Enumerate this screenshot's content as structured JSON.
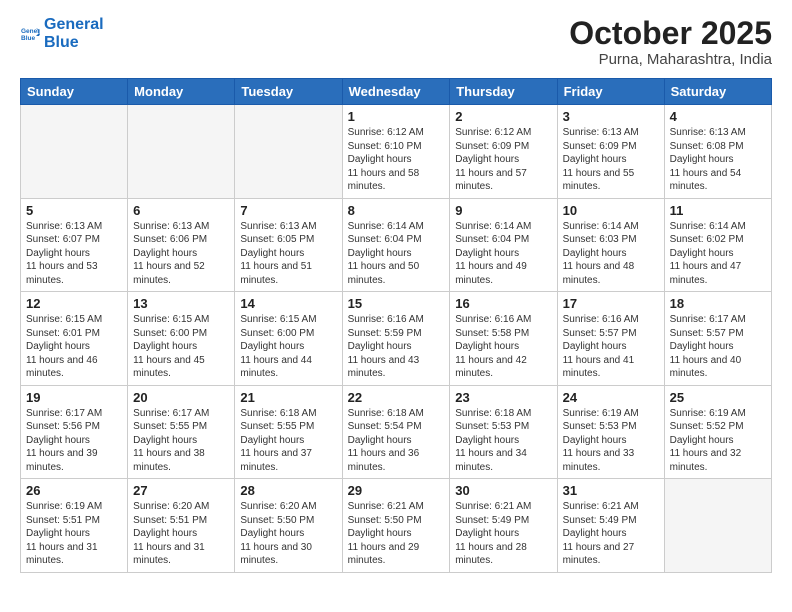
{
  "header": {
    "logo_line1": "General",
    "logo_line2": "Blue",
    "month_title": "October 2025",
    "location": "Purna, Maharashtra, India"
  },
  "weekdays": [
    "Sunday",
    "Monday",
    "Tuesday",
    "Wednesday",
    "Thursday",
    "Friday",
    "Saturday"
  ],
  "weeks": [
    [
      {
        "day": "",
        "empty": true
      },
      {
        "day": "",
        "empty": true
      },
      {
        "day": "",
        "empty": true
      },
      {
        "day": "1",
        "sr": "6:12 AM",
        "ss": "6:10 PM",
        "dl": "11 hours and 58 minutes."
      },
      {
        "day": "2",
        "sr": "6:12 AM",
        "ss": "6:09 PM",
        "dl": "11 hours and 57 minutes."
      },
      {
        "day": "3",
        "sr": "6:13 AM",
        "ss": "6:09 PM",
        "dl": "11 hours and 55 minutes."
      },
      {
        "day": "4",
        "sr": "6:13 AM",
        "ss": "6:08 PM",
        "dl": "11 hours and 54 minutes."
      }
    ],
    [
      {
        "day": "5",
        "sr": "6:13 AM",
        "ss": "6:07 PM",
        "dl": "11 hours and 53 minutes."
      },
      {
        "day": "6",
        "sr": "6:13 AM",
        "ss": "6:06 PM",
        "dl": "11 hours and 52 minutes."
      },
      {
        "day": "7",
        "sr": "6:13 AM",
        "ss": "6:05 PM",
        "dl": "11 hours and 51 minutes."
      },
      {
        "day": "8",
        "sr": "6:14 AM",
        "ss": "6:04 PM",
        "dl": "11 hours and 50 minutes."
      },
      {
        "day": "9",
        "sr": "6:14 AM",
        "ss": "6:04 PM",
        "dl": "11 hours and 49 minutes."
      },
      {
        "day": "10",
        "sr": "6:14 AM",
        "ss": "6:03 PM",
        "dl": "11 hours and 48 minutes."
      },
      {
        "day": "11",
        "sr": "6:14 AM",
        "ss": "6:02 PM",
        "dl": "11 hours and 47 minutes."
      }
    ],
    [
      {
        "day": "12",
        "sr": "6:15 AM",
        "ss": "6:01 PM",
        "dl": "11 hours and 46 minutes."
      },
      {
        "day": "13",
        "sr": "6:15 AM",
        "ss": "6:00 PM",
        "dl": "11 hours and 45 minutes."
      },
      {
        "day": "14",
        "sr": "6:15 AM",
        "ss": "6:00 PM",
        "dl": "11 hours and 44 minutes."
      },
      {
        "day": "15",
        "sr": "6:16 AM",
        "ss": "5:59 PM",
        "dl": "11 hours and 43 minutes."
      },
      {
        "day": "16",
        "sr": "6:16 AM",
        "ss": "5:58 PM",
        "dl": "11 hours and 42 minutes."
      },
      {
        "day": "17",
        "sr": "6:16 AM",
        "ss": "5:57 PM",
        "dl": "11 hours and 41 minutes."
      },
      {
        "day": "18",
        "sr": "6:17 AM",
        "ss": "5:57 PM",
        "dl": "11 hours and 40 minutes."
      }
    ],
    [
      {
        "day": "19",
        "sr": "6:17 AM",
        "ss": "5:56 PM",
        "dl": "11 hours and 39 minutes."
      },
      {
        "day": "20",
        "sr": "6:17 AM",
        "ss": "5:55 PM",
        "dl": "11 hours and 38 minutes."
      },
      {
        "day": "21",
        "sr": "6:18 AM",
        "ss": "5:55 PM",
        "dl": "11 hours and 37 minutes."
      },
      {
        "day": "22",
        "sr": "6:18 AM",
        "ss": "5:54 PM",
        "dl": "11 hours and 36 minutes."
      },
      {
        "day": "23",
        "sr": "6:18 AM",
        "ss": "5:53 PM",
        "dl": "11 hours and 34 minutes."
      },
      {
        "day": "24",
        "sr": "6:19 AM",
        "ss": "5:53 PM",
        "dl": "11 hours and 33 minutes."
      },
      {
        "day": "25",
        "sr": "6:19 AM",
        "ss": "5:52 PM",
        "dl": "11 hours and 32 minutes."
      }
    ],
    [
      {
        "day": "26",
        "sr": "6:19 AM",
        "ss": "5:51 PM",
        "dl": "11 hours and 31 minutes."
      },
      {
        "day": "27",
        "sr": "6:20 AM",
        "ss": "5:51 PM",
        "dl": "11 hours and 31 minutes."
      },
      {
        "day": "28",
        "sr": "6:20 AM",
        "ss": "5:50 PM",
        "dl": "11 hours and 30 minutes."
      },
      {
        "day": "29",
        "sr": "6:21 AM",
        "ss": "5:50 PM",
        "dl": "11 hours and 29 minutes."
      },
      {
        "day": "30",
        "sr": "6:21 AM",
        "ss": "5:49 PM",
        "dl": "11 hours and 28 minutes."
      },
      {
        "day": "31",
        "sr": "6:21 AM",
        "ss": "5:49 PM",
        "dl": "11 hours and 27 minutes."
      },
      {
        "day": "",
        "empty": true
      }
    ]
  ]
}
